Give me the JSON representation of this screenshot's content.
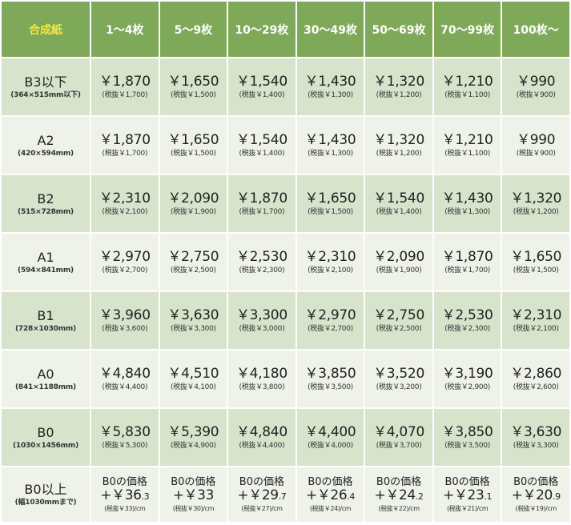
{
  "header": {
    "corner": "合成紙",
    "columns": [
      "1〜4枚",
      "5〜9枚",
      "10〜29枚",
      "30〜49枚",
      "50〜69枚",
      "70〜99枚",
      "100枚〜"
    ]
  },
  "rows": [
    {
      "name": "B3以下",
      "dims": "(364×515mm以下)",
      "cells": [
        {
          "price": "￥1,870",
          "tax_excl": "(税抜￥1,700)"
        },
        {
          "price": "￥1,650",
          "tax_excl": "(税抜￥1,500)"
        },
        {
          "price": "￥1,540",
          "tax_excl": "(税抜￥1,400)"
        },
        {
          "price": "￥1,430",
          "tax_excl": "(税抜￥1,300)"
        },
        {
          "price": "￥1,320",
          "tax_excl": "(税抜￥1,200)"
        },
        {
          "price": "￥1,210",
          "tax_excl": "(税抜￥1,100)"
        },
        {
          "price": "￥990",
          "tax_excl": "(税抜￥900)"
        }
      ]
    },
    {
      "name": "A2",
      "dims": "(420×594mm)",
      "cells": [
        {
          "price": "￥1,870",
          "tax_excl": "(税抜￥1,700)"
        },
        {
          "price": "￥1,650",
          "tax_excl": "(税抜￥1,500)"
        },
        {
          "price": "￥1,540",
          "tax_excl": "(税抜￥1,400)"
        },
        {
          "price": "￥1,430",
          "tax_excl": "(税抜￥1,300)"
        },
        {
          "price": "￥1,320",
          "tax_excl": "(税抜￥1,200)"
        },
        {
          "price": "￥1,210",
          "tax_excl": "(税抜￥1,100)"
        },
        {
          "price": "￥990",
          "tax_excl": "(税抜￥900)"
        }
      ]
    },
    {
      "name": "B2",
      "dims": "(515×728mm)",
      "cells": [
        {
          "price": "￥2,310",
          "tax_excl": "(税抜￥2,100)"
        },
        {
          "price": "￥2,090",
          "tax_excl": "(税抜￥1,900)"
        },
        {
          "price": "￥1,870",
          "tax_excl": "(税抜￥1,700)"
        },
        {
          "price": "￥1,650",
          "tax_excl": "(税抜￥1,500)"
        },
        {
          "price": "￥1,540",
          "tax_excl": "(税抜￥1,400)"
        },
        {
          "price": "￥1,430",
          "tax_excl": "(税抜￥1,300)"
        },
        {
          "price": "￥1,320",
          "tax_excl": "(税抜￥1,200)"
        }
      ]
    },
    {
      "name": "A1",
      "dims": "(594×841mm)",
      "cells": [
        {
          "price": "￥2,970",
          "tax_excl": "(税抜￥2,700)"
        },
        {
          "price": "￥2,750",
          "tax_excl": "(税抜￥2,500)"
        },
        {
          "price": "￥2,530",
          "tax_excl": "(税抜￥2,300)"
        },
        {
          "price": "￥2,310",
          "tax_excl": "(税抜￥2,100)"
        },
        {
          "price": "￥2,090",
          "tax_excl": "(税抜￥1,900)"
        },
        {
          "price": "￥1,870",
          "tax_excl": "(税抜￥1,700)"
        },
        {
          "price": "￥1,650",
          "tax_excl": "(税抜￥1,500)"
        }
      ]
    },
    {
      "name": "B1",
      "dims": "(728×1030mm)",
      "cells": [
        {
          "price": "￥3,960",
          "tax_excl": "(税抜￥3,600)"
        },
        {
          "price": "￥3,630",
          "tax_excl": "(税抜￥3,300)"
        },
        {
          "price": "￥3,300",
          "tax_excl": "(税抜￥3,000)"
        },
        {
          "price": "￥2,970",
          "tax_excl": "(税抜￥2,700)"
        },
        {
          "price": "￥2,750",
          "tax_excl": "(税抜￥2,500)"
        },
        {
          "price": "￥2,530",
          "tax_excl": "(税抜￥2,300)"
        },
        {
          "price": "￥2,310",
          "tax_excl": "(税抜￥2,100)"
        }
      ]
    },
    {
      "name": "A0",
      "dims": "(841×1188mm)",
      "cells": [
        {
          "price": "￥4,840",
          "tax_excl": "(税抜￥4,400)"
        },
        {
          "price": "￥4,510",
          "tax_excl": "(税抜￥4,100)"
        },
        {
          "price": "￥4,180",
          "tax_excl": "(税抜￥3,800)"
        },
        {
          "price": "￥3,850",
          "tax_excl": "(税抜￥3,500)"
        },
        {
          "price": "￥3,520",
          "tax_excl": "(税抜￥3,200)"
        },
        {
          "price": "￥3,190",
          "tax_excl": "(税抜￥2,900)"
        },
        {
          "price": "￥2,860",
          "tax_excl": "(税抜￥2,600)"
        }
      ]
    },
    {
      "name": "B0",
      "dims": "(1030×1456mm)",
      "cells": [
        {
          "price": "￥5,830",
          "tax_excl": "(税抜￥5,300)"
        },
        {
          "price": "￥5,390",
          "tax_excl": "(税抜￥4,900)"
        },
        {
          "price": "￥4,840",
          "tax_excl": "(税抜￥4,400)"
        },
        {
          "price": "￥4,400",
          "tax_excl": "(税抜￥4,000)"
        },
        {
          "price": "￥4,070",
          "tax_excl": "(税抜￥3,700)"
        },
        {
          "price": "￥3,850",
          "tax_excl": "(税抜￥3,500)"
        },
        {
          "price": "￥3,630",
          "tax_excl": "(税抜￥3,300)"
        }
      ]
    }
  ],
  "b0plus": {
    "name": "B0以上",
    "dims": "(幅1030mmまで)",
    "cells": [
      {
        "label": "B0の価格",
        "plus": "+￥36",
        "decimal": ".3",
        "tax_excl": "(税抜￥33)/cm"
      },
      {
        "label": "B0の価格",
        "plus": "+￥33",
        "decimal": "",
        "tax_excl": "(税抜￥30)/cm"
      },
      {
        "label": "B0の価格",
        "plus": "+￥29",
        "decimal": ".7",
        "tax_excl": "(税抜￥27)/cm"
      },
      {
        "label": "B0の価格",
        "plus": "+￥26",
        "decimal": ".4",
        "tax_excl": "(税抜￥24)/cm"
      },
      {
        "label": "B0の価格",
        "plus": "+￥24",
        "decimal": ".2",
        "tax_excl": "(税抜￥22)/cm"
      },
      {
        "label": "B0の価格",
        "plus": "+￥23",
        "decimal": ".1",
        "tax_excl": "(税抜￥21)/cm"
      },
      {
        "label": "B0の価格",
        "plus": "+￥20",
        "decimal": ".9",
        "tax_excl": "(税抜￥19)/cm"
      }
    ]
  },
  "colors": {
    "header_bg": "#7ea958",
    "header_text": "#ffffff",
    "corner_text": "#f3e64a",
    "row_dark": "#d7e3cb",
    "row_light": "#eef2e9"
  }
}
